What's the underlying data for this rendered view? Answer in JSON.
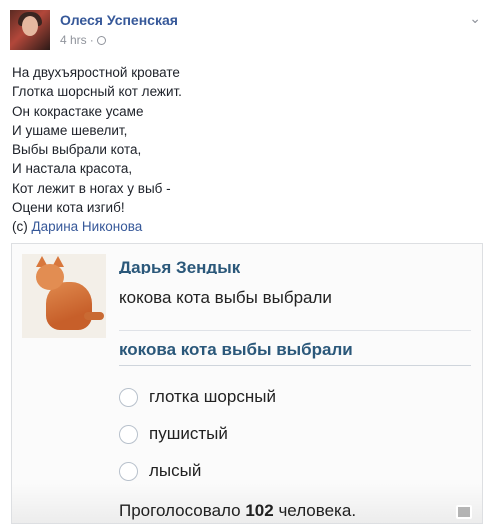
{
  "post": {
    "author": "Олеся Успенская",
    "time": "4 hrs",
    "privacy_icon": "globe-icon",
    "menu_icon": "chevron-down-icon",
    "lines": [
      "На двухъяростной кровате",
      "Глотка шорсный кот лежит.",
      "Он кокрастаке усаме",
      "И ушаме шевелит,",
      "Выбы выбрали кота,",
      "И настала красота,",
      "Кот лежит в ногах у выб -",
      "Оцени кота изгиб!"
    ],
    "credit_prefix": "(с) ",
    "credit_name": "Дарина Никонова"
  },
  "poll_image": {
    "user": "Дарья Зендык",
    "question_plain": "кокова кота выбы выбрали",
    "question_title": "кокова кота выбы выбрали",
    "options": [
      "глотка шорсный",
      "пушистый",
      "лысый"
    ],
    "votes_prefix": "Проголосовало ",
    "votes_count": "102",
    "votes_suffix": " человека."
  }
}
